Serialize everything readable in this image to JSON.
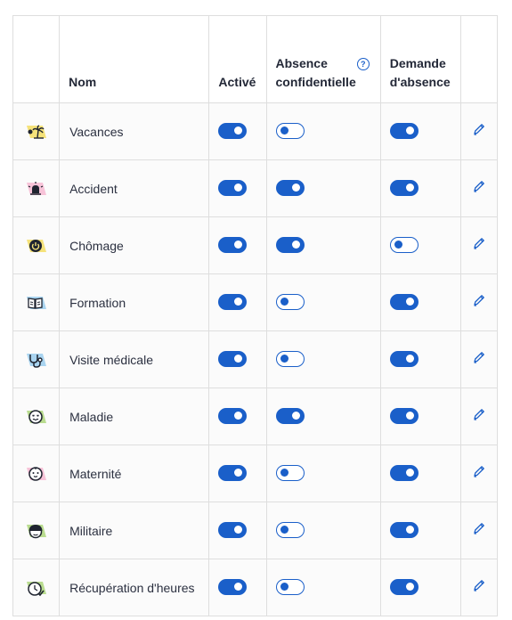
{
  "headers": {
    "name": "Nom",
    "active": "Activé",
    "confidential": "Absence confidentielle",
    "request": "Demande d'absence"
  },
  "colors": {
    "accent": "#1a5fc9",
    "border": "#dedede"
  },
  "rows": [
    {
      "name": "Vacances",
      "icon": "vacation-icon",
      "active": true,
      "confidential": false,
      "request": true
    },
    {
      "name": "Accident",
      "icon": "siren-icon",
      "active": true,
      "confidential": true,
      "request": true
    },
    {
      "name": "Chômage",
      "icon": "power-icon",
      "active": true,
      "confidential": true,
      "request": false
    },
    {
      "name": "Formation",
      "icon": "book-icon",
      "active": true,
      "confidential": false,
      "request": true
    },
    {
      "name": "Visite médicale",
      "icon": "stethoscope-icon",
      "active": true,
      "confidential": false,
      "request": true
    },
    {
      "name": "Maladie",
      "icon": "sick-face-icon",
      "active": true,
      "confidential": true,
      "request": true
    },
    {
      "name": "Maternité",
      "icon": "baby-face-icon",
      "active": true,
      "confidential": false,
      "request": true
    },
    {
      "name": "Militaire",
      "icon": "soldier-helmet-icon",
      "active": true,
      "confidential": false,
      "request": true
    },
    {
      "name": "Récupération d'heures",
      "icon": "clock-check-icon",
      "active": true,
      "confidential": false,
      "request": true
    }
  ]
}
